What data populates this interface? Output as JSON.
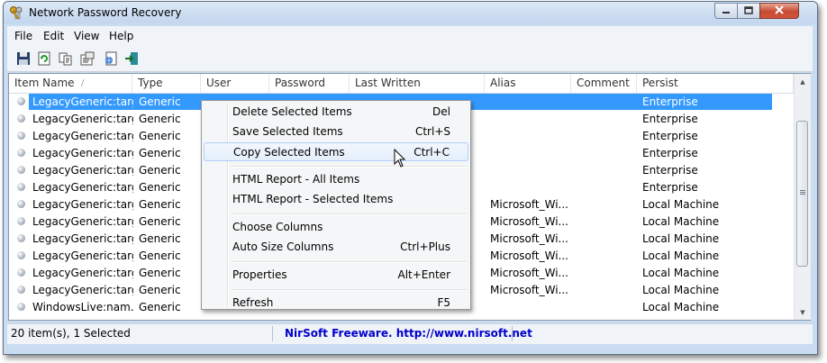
{
  "window": {
    "title": "Network Password Recovery",
    "icon": "keys-icon",
    "controls": [
      "minimize-icon",
      "maximize-icon",
      "close-icon"
    ]
  },
  "menu": [
    "File",
    "Edit",
    "View",
    "Help"
  ],
  "toolbar": [
    "save-icon",
    "refresh-icon",
    "copy-icon",
    "properties-icon",
    "html-report-icon",
    "exit-icon"
  ],
  "columns": [
    "Item Name",
    "Type",
    "User",
    "Password",
    "Last Written",
    "Alias",
    "Comment",
    "Persist"
  ],
  "rows": [
    {
      "item": "LegacyGeneric:targ...",
      "type": "Generic",
      "alias": "",
      "persist": "Enterprise",
      "selected": true
    },
    {
      "item": "LegacyGeneric:targ...",
      "type": "Generic",
      "alias": "",
      "persist": "Enterprise"
    },
    {
      "item": "LegacyGeneric:targ...",
      "type": "Generic",
      "alias": "",
      "persist": "Enterprise"
    },
    {
      "item": "LegacyGeneric:targ...",
      "type": "Generic",
      "alias": "",
      "persist": "Enterprise"
    },
    {
      "item": "LegacyGeneric:targ...",
      "type": "Generic",
      "alias": "",
      "persist": "Enterprise"
    },
    {
      "item": "LegacyGeneric:targ...",
      "type": "Generic",
      "alias": "",
      "persist": "Enterprise"
    },
    {
      "item": "LegacyGeneric:targ...",
      "type": "Generic",
      "alias": "Microsoft_Wi...",
      "persist": "Local Machine"
    },
    {
      "item": "LegacyGeneric:targ...",
      "type": "Generic",
      "alias": "Microsoft_Wi...",
      "persist": "Local Machine"
    },
    {
      "item": "LegacyGeneric:targ...",
      "type": "Generic",
      "alias": "Microsoft_Wi...",
      "persist": "Local Machine"
    },
    {
      "item": "LegacyGeneric:targ...",
      "type": "Generic",
      "alias": "Microsoft_Wi...",
      "persist": "Local Machine"
    },
    {
      "item": "LegacyGeneric:targ...",
      "type": "Generic",
      "alias": "Microsoft_Wi...",
      "persist": "Local Machine"
    },
    {
      "item": "LegacyGeneric:targ...",
      "type": "Generic",
      "alias": "Microsoft_Wi...",
      "persist": "Local Machine"
    },
    {
      "item": "WindowsLive:nam...",
      "type": "Generic",
      "alias": "",
      "persist": "Local Machine"
    }
  ],
  "context_menu": [
    {
      "label": "Delete Selected Items",
      "shortcut": "Del"
    },
    {
      "label": "Save Selected Items",
      "shortcut": "Ctrl+S"
    },
    {
      "label": "Copy Selected Items",
      "shortcut": "Ctrl+C",
      "hover": true
    },
    {
      "separator": true
    },
    {
      "label": "HTML Report - All Items",
      "shortcut": ""
    },
    {
      "label": "HTML Report - Selected Items",
      "shortcut": ""
    },
    {
      "separator": true
    },
    {
      "label": "Choose Columns",
      "shortcut": ""
    },
    {
      "label": "Auto Size Columns",
      "shortcut": "Ctrl+Plus"
    },
    {
      "separator": true
    },
    {
      "label": "Properties",
      "shortcut": "Alt+Enter"
    },
    {
      "separator": true
    },
    {
      "label": "Refresh",
      "shortcut": "F5"
    }
  ],
  "status": {
    "count": "20 item(s), 1 Selected",
    "link": "NirSoft Freeware.  http://www.nirsoft.net"
  },
  "colors": {
    "selection": "#3399ff",
    "link": "#0000cc",
    "close_button": "#c74a32"
  }
}
